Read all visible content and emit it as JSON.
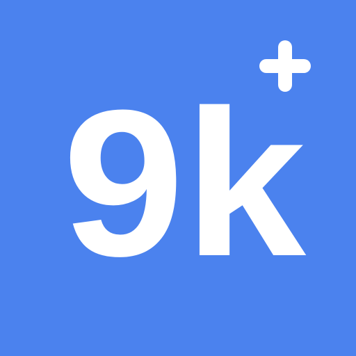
{
  "icon": {
    "glyph_text": "9k",
    "superscript": "plus-icon",
    "colors": {
      "background": "#4B82EE",
      "foreground": "#FFFFFF"
    }
  }
}
